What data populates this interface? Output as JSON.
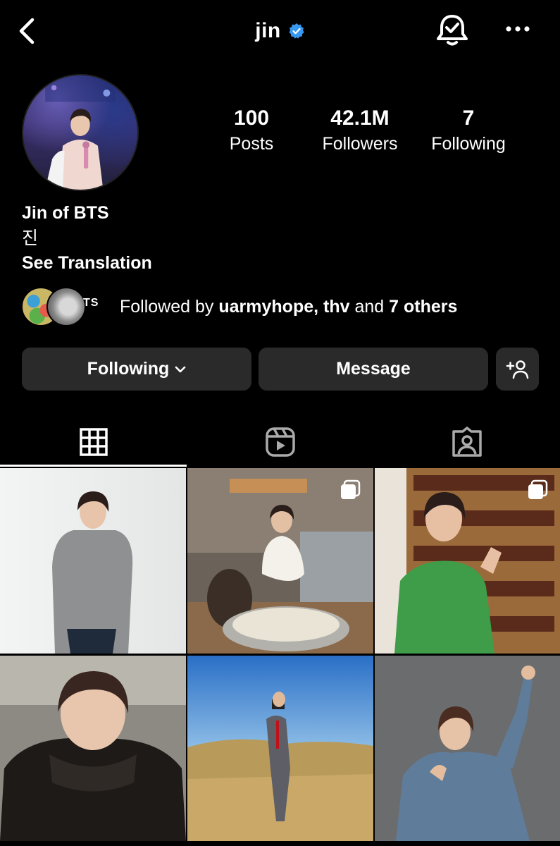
{
  "header": {
    "username": "jin",
    "verified": true,
    "accent_color": "#3897f0"
  },
  "profile": {
    "display_name": "Jin of BTS",
    "bio": "진",
    "see_translation": "See Translation",
    "stats": [
      {
        "value": "100",
        "label": "Posts"
      },
      {
        "value": "42.1M",
        "label": "Followers"
      },
      {
        "value": "7",
        "label": "Following"
      }
    ]
  },
  "mutuals": {
    "avatar_third_text": "TS",
    "prefix": "Followed by ",
    "names": "uarmyhope, thv",
    "middle": " and ",
    "others": "7 others"
  },
  "actions": {
    "following_label": "Following",
    "message_label": "Message"
  },
  "tabs": [
    {
      "name": "posts-grid",
      "icon": "grid-icon",
      "active": true
    },
    {
      "name": "reels",
      "icon": "reels-icon",
      "active": false
    },
    {
      "name": "tagged",
      "icon": "tagged-icon",
      "active": false
    }
  ],
  "posts": [
    {
      "scene": "man in grey sweater against white wall",
      "multi": false
    },
    {
      "scene": "man in white sweater in kitchen with rice",
      "multi": true
    },
    {
      "scene": "man in green sweater waving in shop with bottles",
      "multi": true
    },
    {
      "scene": "selfie in black shearling jacket",
      "multi": false
    },
    {
      "scene": "man in plaid suit in field with camera",
      "multi": false
    },
    {
      "scene": "man in denim jacket raising fist",
      "multi": false
    }
  ]
}
